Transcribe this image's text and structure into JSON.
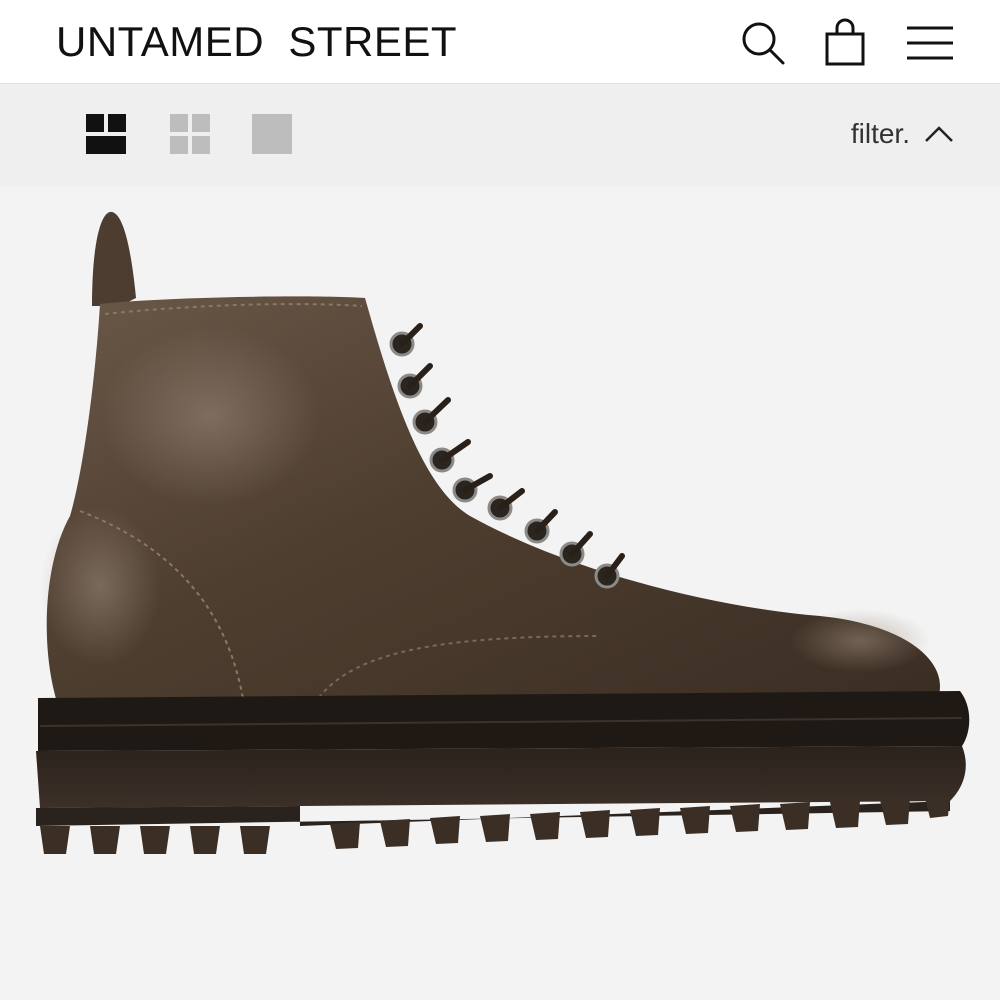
{
  "header": {
    "brand": "UNTAMED  STREET",
    "icons": [
      "search-icon",
      "shopping-bag-icon",
      "hamburger-menu-icon"
    ]
  },
  "toolbar": {
    "view_options": [
      "grid-large-icon",
      "grid-four-icon",
      "grid-single-icon"
    ],
    "active_view": "grid-large-icon",
    "filter_label": "filter.",
    "filter_icon": "chevron-up-icon"
  },
  "product": {
    "image": "brown-leather-lace-up-boot"
  },
  "colors": {
    "text": "#111111",
    "toolbar_bg": "#efefef",
    "inactive_icon": "#bdbdbd",
    "product_bg": "#f3f3f3",
    "leather": "#4a3a2c",
    "sole": "#2e2620"
  }
}
